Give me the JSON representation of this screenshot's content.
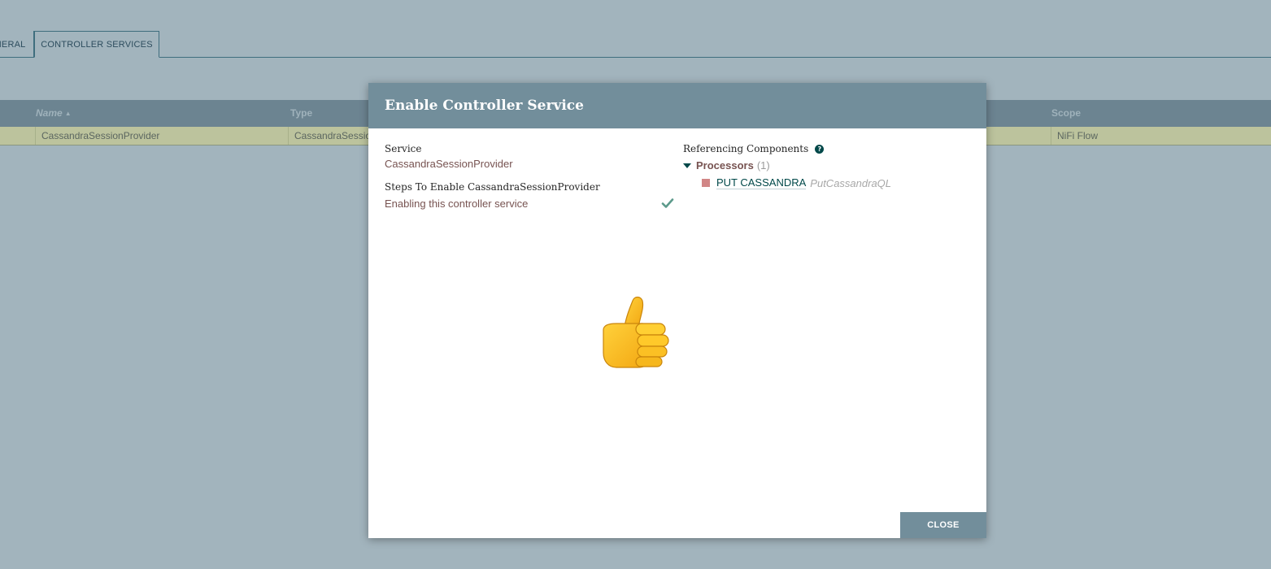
{
  "tabs": [
    {
      "label": "GENERAL"
    },
    {
      "label": "CONTROLLER SERVICES"
    }
  ],
  "table": {
    "columns": {
      "name": "Name",
      "type": "Type",
      "scope": "Scope"
    },
    "rows": [
      {
        "name": "CassandraSessionProvider",
        "type": "CassandraSessionProvider",
        "scope": "NiFi Flow"
      }
    ]
  },
  "dialog": {
    "title": "Enable Controller Service",
    "service_label": "Service",
    "service_value": "CassandraSessionProvider",
    "steps_label": "Steps To Enable CassandraSessionProvider",
    "steps": [
      {
        "text": "Enabling this controller service",
        "status_icon": "check-icon"
      }
    ],
    "referencing_label": "Referencing Components",
    "processors_label": "Processors",
    "processors_count": "(1)",
    "processors": [
      {
        "name": "PUT CASSANDRA",
        "type": "PutCassandraQL",
        "state_icon": "stopped-icon"
      }
    ],
    "close_label": "CLOSE"
  },
  "colors": {
    "overlay": "#a2b4bd",
    "dialog_header": "#728e9b",
    "accent_value": "#775351",
    "link": "#004849",
    "success": "#5c9a8b",
    "stopped": "#d18686"
  }
}
